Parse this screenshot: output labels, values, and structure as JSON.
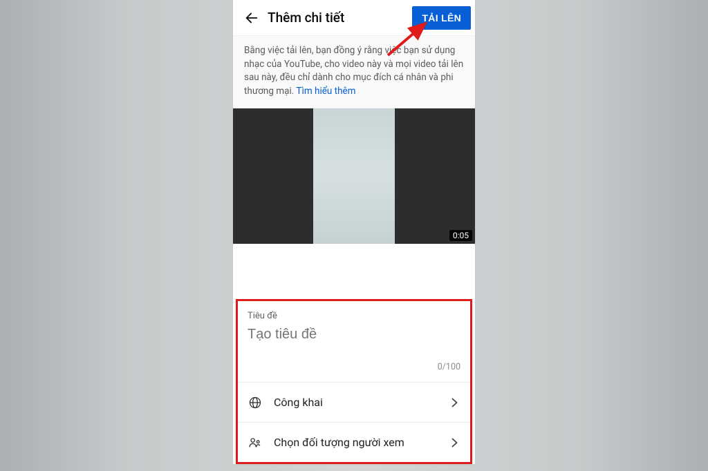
{
  "header": {
    "title": "Thêm chi tiết",
    "upload_label": "TẢI LÊN"
  },
  "notice": {
    "text": "Bằng việc tải lên, bạn đồng ý rằng việc bạn sử dụng nhạc của YouTube, cho video này và mọi video tải lên sau này, đều chỉ dành cho mục đích cá nhân và phi thương mại. ",
    "link": "Tìm hiểu thêm"
  },
  "video": {
    "duration": "0:05"
  },
  "form": {
    "title_label": "Tiêu đề",
    "title_placeholder": "Tạo tiêu đề",
    "char_counter": "0/100",
    "visibility_label": "Công khai",
    "audience_label": "Chọn đối tượng người xem"
  },
  "colors": {
    "accent": "#065fd4",
    "highlight": "#e11b1b"
  }
}
